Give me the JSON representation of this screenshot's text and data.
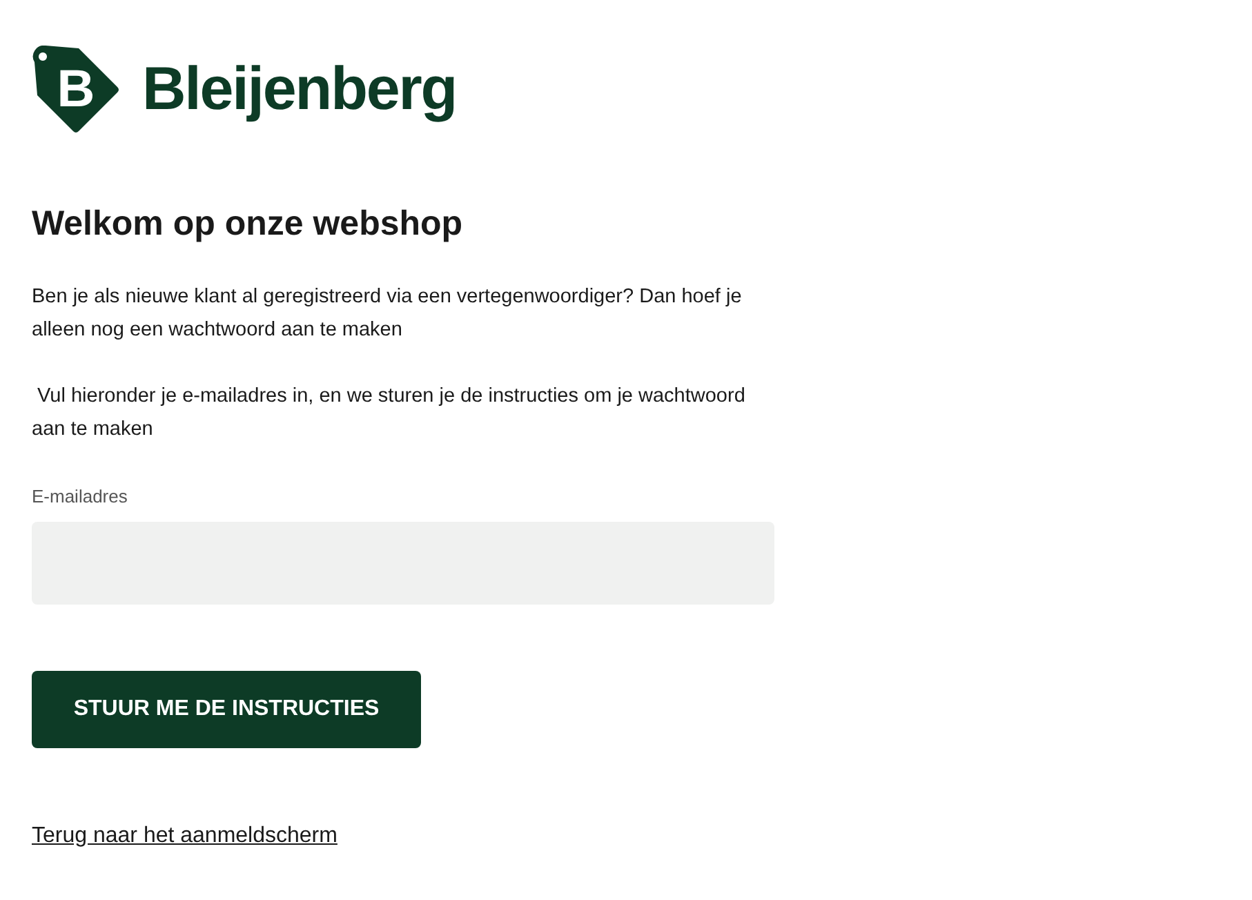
{
  "logo": {
    "mark": "B",
    "name": "Bleijenberg"
  },
  "title": "Welkom op onze webshop",
  "paragraphs": [
    "Ben je als nieuwe klant al geregistreerd via een vertegenwoordiger? Dan hoef je alleen nog een wachtwoord aan te maken",
    " Vul hieronder je e-mailadres in, en we sturen je de instructies om je wachtwoord aan te maken"
  ],
  "email_field": {
    "label": "E-mailadres"
  },
  "submit_button": "STUUR ME DE INSTRUCTIES",
  "back_link": "Terug naar het aanmeldscherm"
}
